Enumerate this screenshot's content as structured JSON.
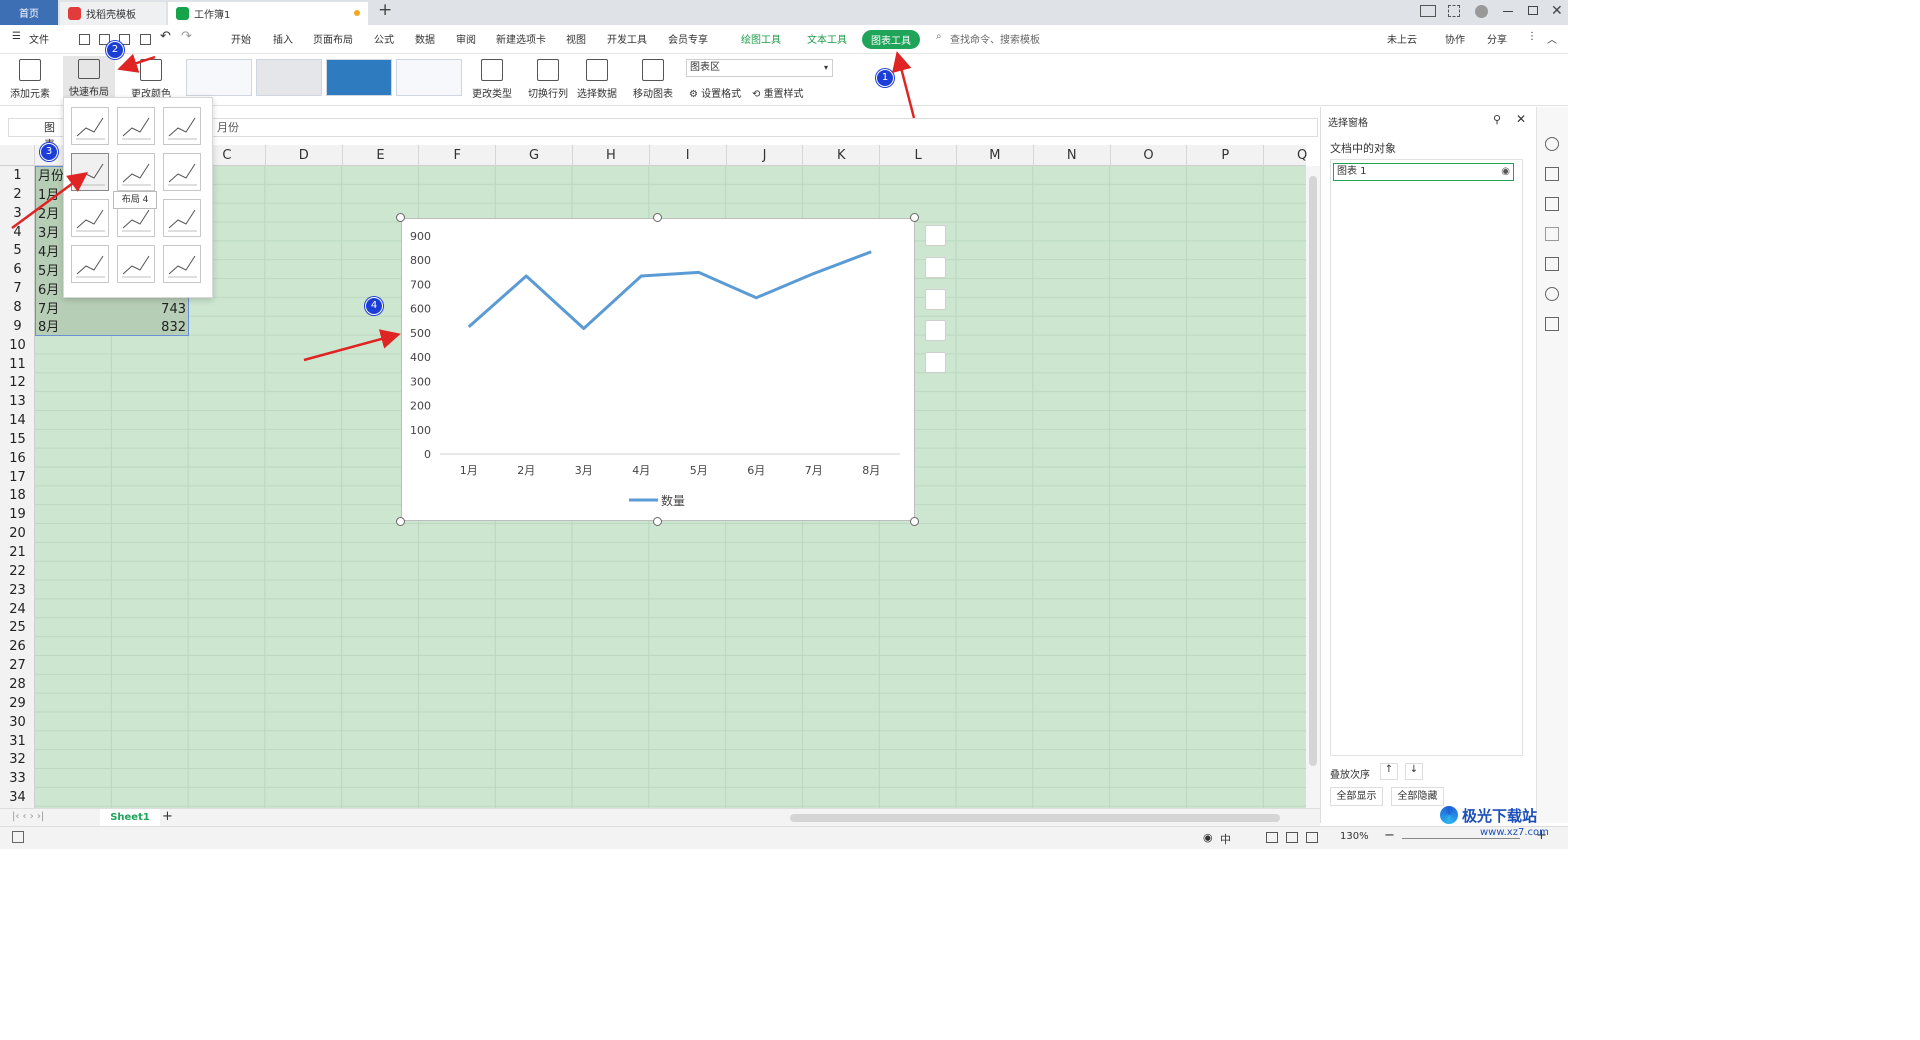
{
  "tabs": {
    "home": "首页",
    "template": "找稻壳模板",
    "workbook": "工作簿1",
    "add": "+"
  },
  "menu": {
    "file": "文件",
    "items": [
      "开始",
      "插入",
      "页面布局",
      "公式",
      "数据",
      "审阅",
      "新建选项卡",
      "视图",
      "开发工具",
      "会员专享"
    ],
    "draw_tools": "绘图工具",
    "text_tools": "文本工具",
    "chart_tools": "图表工具",
    "search": "查找命令、搜索模板",
    "cloud": "未上云",
    "collab": "协作",
    "share": "分享"
  },
  "ribbon": {
    "add_element": "添加元素",
    "quick_layout": "快速布局",
    "change_color": "更改颜色",
    "change_type": "更改类型",
    "switch_rowcol": "切换行列",
    "select_data": "选择数据",
    "move_chart": "移动图表",
    "area_select": "图表区",
    "set_format": "设置格式",
    "reset_style": "重置样式"
  },
  "formula": {
    "namebox": "图表",
    "content": "月份"
  },
  "columns": [
    "C",
    "D",
    "E",
    "F",
    "G",
    "H",
    "I",
    "J",
    "K",
    "L",
    "M",
    "N",
    "O",
    "P",
    "Q"
  ],
  "rows": [
    "1",
    "2",
    "3",
    "4",
    "5",
    "6",
    "7",
    "8",
    "9",
    "10",
    "11",
    "12",
    "13",
    "14",
    "15",
    "16",
    "17",
    "18",
    "19",
    "20",
    "21",
    "22",
    "23",
    "24",
    "25",
    "26",
    "27",
    "28",
    "29",
    "30",
    "31",
    "32",
    "33",
    "34"
  ],
  "cells": {
    "a1": "月份",
    "a2": "1月",
    "a3": "2月",
    "a4": "3月",
    "a5": "4月",
    "a6": "5月",
    "a7": "6月",
    "a8": "7月",
    "a9": "8月",
    "b8": "743",
    "b9": "832"
  },
  "popup": {
    "tooltip": "布局 4"
  },
  "chart_data": {
    "type": "line",
    "categories": [
      "1月",
      "2月",
      "3月",
      "4月",
      "5月",
      "6月",
      "7月",
      "8月"
    ],
    "series": [
      {
        "name": "数量",
        "values": [
          525,
          735,
          518,
          735,
          750,
          645,
          745,
          835
        ],
        "color": "#5b9bd5"
      }
    ],
    "ylim": [
      0,
      900
    ],
    "yticks": [
      0,
      100,
      200,
      300,
      400,
      500,
      600,
      700,
      800,
      900
    ],
    "legend": "bottom",
    "grid": false
  },
  "right_pane": {
    "title": "选择窗格",
    "subtitle": "文档中的对象",
    "object": "图表 1",
    "order": "叠放次序",
    "show_all": "全部显示",
    "hide_all": "全部隐藏"
  },
  "sheet": {
    "name": "Sheet1"
  },
  "status": {
    "zoom": "130%",
    "lang": "中"
  },
  "badges": [
    "1",
    "2",
    "3",
    "4"
  ],
  "watermark": {
    "text": "极光下载站",
    "url": "www.xz7.com"
  }
}
